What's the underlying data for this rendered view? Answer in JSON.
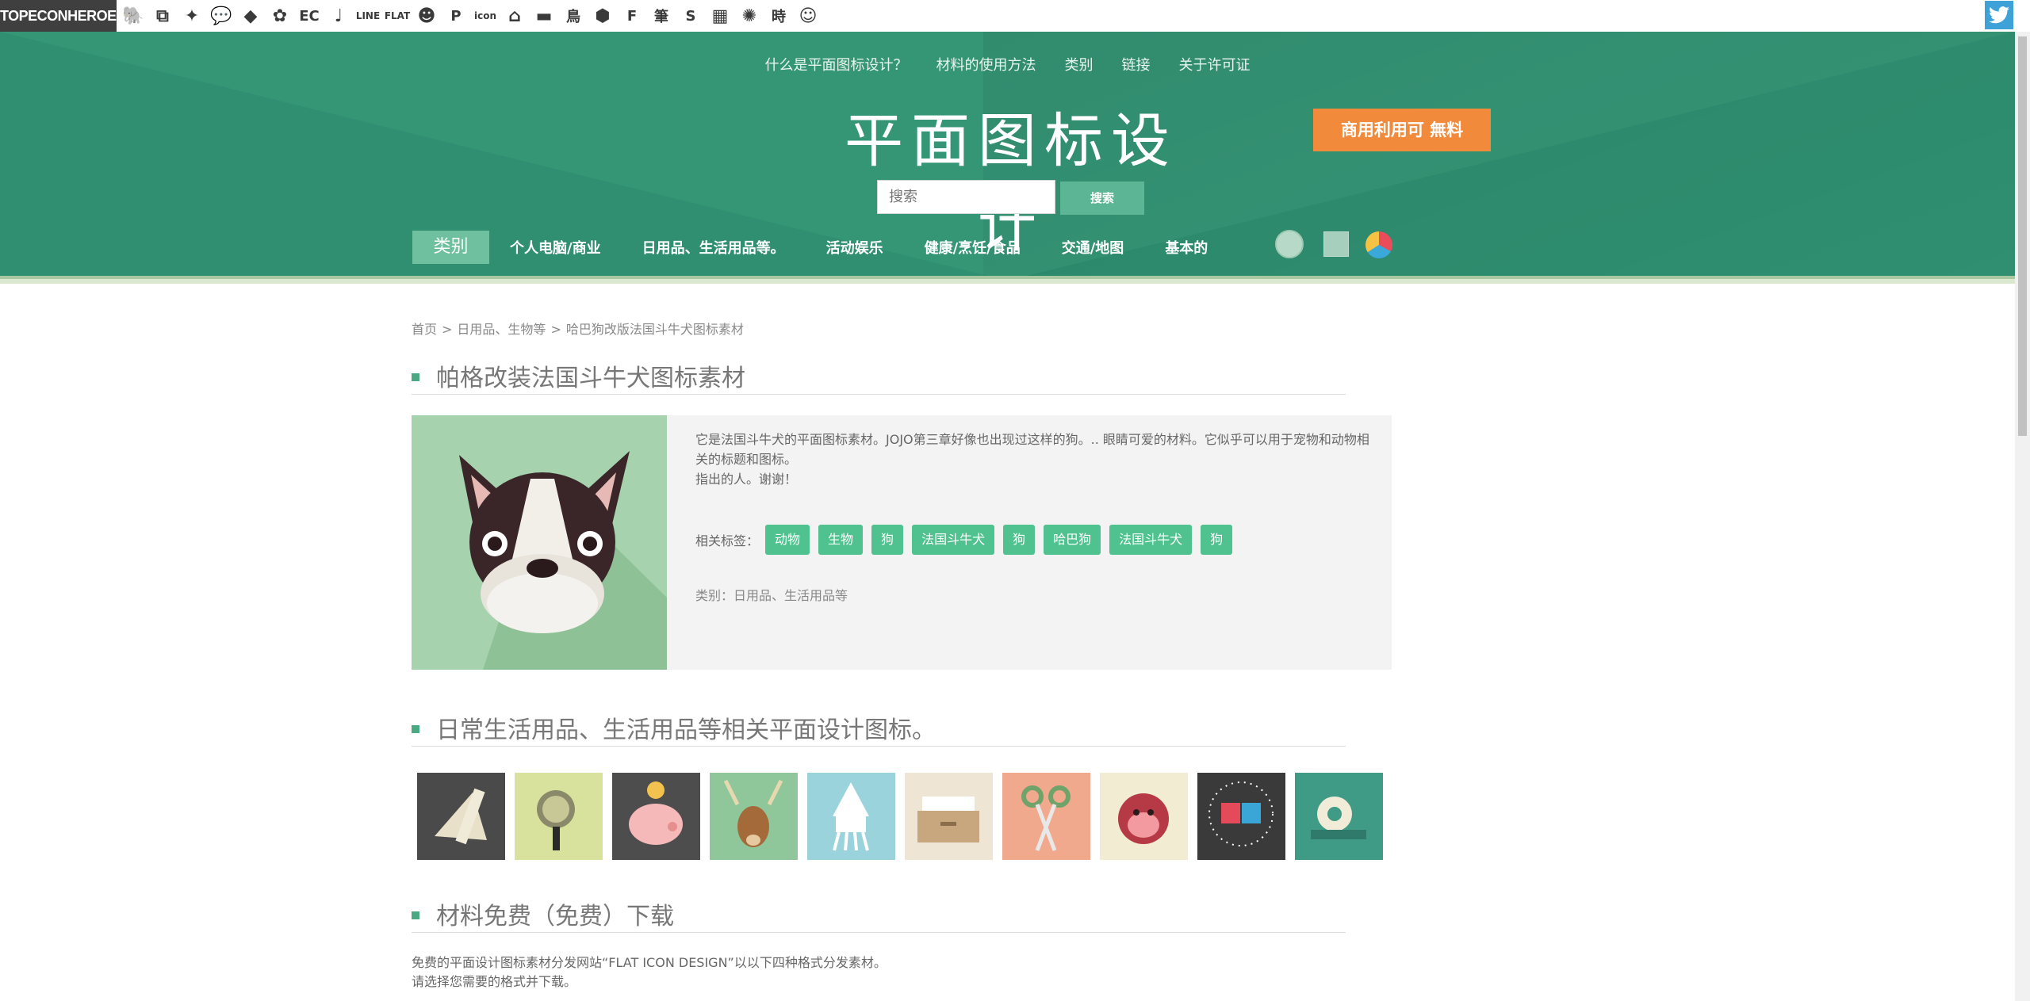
{
  "topbar": {
    "brand": "TOPECONHEROES",
    "icons": [
      {
        "name": "elephant-icon",
        "glyph": "🐘",
        "size": "normal"
      },
      {
        "name": "copy-icon",
        "glyph": "⧉",
        "size": "normal"
      },
      {
        "name": "dancer-icon",
        "glyph": "✦",
        "size": "normal"
      },
      {
        "name": "speech-bubble-icon",
        "glyph": "💬",
        "size": "normal"
      },
      {
        "name": "fish-icon",
        "glyph": "◆",
        "size": "normal"
      },
      {
        "name": "flower-icon",
        "glyph": "✿",
        "size": "normal"
      },
      {
        "name": "ec-icon",
        "glyph": "EC",
        "size": "txt"
      },
      {
        "name": "music-note-icon",
        "glyph": "♩",
        "size": "normal"
      },
      {
        "name": "line-icon",
        "glyph": "LINE",
        "size": "tiny"
      },
      {
        "name": "flat-icon",
        "glyph": "FLAT",
        "size": "tiny"
      },
      {
        "name": "smile-icon",
        "glyph": "☻",
        "size": "normal"
      },
      {
        "name": "parking-icon",
        "glyph": "P",
        "size": "txt"
      },
      {
        "name": "icon-text-icon",
        "glyph": "icon",
        "size": "tiny"
      },
      {
        "name": "house-icon",
        "glyph": "⌂",
        "size": "normal"
      },
      {
        "name": "sofa-icon",
        "glyph": "▬",
        "size": "normal"
      },
      {
        "name": "bird-kanji-icon",
        "glyph": "鳥",
        "size": "txt"
      },
      {
        "name": "hexagon-icon",
        "glyph": "⬢",
        "size": "normal"
      },
      {
        "name": "f-letter-icon",
        "glyph": "F",
        "size": "txt"
      },
      {
        "name": "brush-kanji-icon",
        "glyph": "筆",
        "size": "txt"
      },
      {
        "name": "s-letter-icon",
        "glyph": "S",
        "size": "txt"
      },
      {
        "name": "grid-icon",
        "glyph": "▦",
        "size": "normal"
      },
      {
        "name": "sunburst-icon",
        "glyph": "✺",
        "size": "normal"
      },
      {
        "name": "time-kanji-icon",
        "glyph": "時",
        "size": "txt"
      },
      {
        "name": "face-icon",
        "glyph": "☺",
        "size": "normal"
      }
    ]
  },
  "topnav": [
    "什么是平面图标设计？",
    "材料的使用方法",
    "类别",
    "链接",
    "关于许可证"
  ],
  "site_title": "平面图标设计",
  "commercial_button": "商用利用可 無料",
  "search": {
    "placeholder": "搜索",
    "button": "搜索"
  },
  "category_nav": {
    "label": "类别",
    "items": [
      "个人电脑/商业",
      "日用品、生活用品等。",
      "活动娱乐",
      "健康/烹饪/食品",
      "交通/地图",
      "基本的"
    ]
  },
  "breadcrumb": {
    "home": "首页",
    "category": "日用品、生物等",
    "current": "哈巴狗改版法国斗牛犬图标素材",
    "separator": ">"
  },
  "item": {
    "title": "帕格改装法国斗牛犬图标素材",
    "description_1": "它是法国斗牛犬的平面图标素材。JOJO第三章好像也出现过这样的狗。.. 眼睛可爱的材料。它似乎可以用于宠物和动物相关的标题和图标。",
    "description_2": "指出的人。谢谢！",
    "tags_label": "相关标签：",
    "tags": [
      "动物",
      "生物",
      "狗",
      "法国斗牛犬",
      "狗",
      "哈巴狗",
      "法国斗牛犬",
      "狗"
    ],
    "category_label": "类别：",
    "category_value": "日用品、生活用品等"
  },
  "related": {
    "title": "日常生活用品、生活用品等相关平面设计图标。",
    "thumbnails": [
      {
        "name": "ruler-set-icon",
        "bg": "#4a4a4a"
      },
      {
        "name": "magnifier-icon",
        "bg": "#d9e29c"
      },
      {
        "name": "piggy-bank-icon",
        "bg": "#4d4d4d"
      },
      {
        "name": "deer-icon",
        "bg": "#8fc79b"
      },
      {
        "name": "squid-icon",
        "bg": "#9bd3dc"
      },
      {
        "name": "file-tray-icon",
        "bg": "#efe5d4"
      },
      {
        "name": "scissors-icon",
        "bg": "#f0a98d"
      },
      {
        "name": "monkey-icon",
        "bg": "#f2ecd2"
      },
      {
        "name": "magnet-icon",
        "bg": "#3a3a3a"
      },
      {
        "name": "tape-icon",
        "bg": "#3f9a86"
      }
    ]
  },
  "download": {
    "title": "材料免费（免费）下载",
    "line_1": "免费的平面设计图标素材分发网站“FLAT ICON DESIGN”以以下四种格式分发素材。",
    "line_2": "请选择您需要的格式并下载。"
  },
  "colors": {
    "header": "#2f8f70",
    "accent": "#4aa983",
    "tag": "#4fc28f",
    "commercial": "#f18a3b"
  }
}
